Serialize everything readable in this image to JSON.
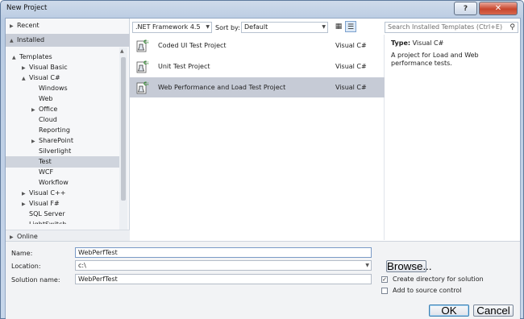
{
  "window": {
    "title": "New Project",
    "help_label": "?",
    "close_label": "✕"
  },
  "left": {
    "recent": "Recent",
    "installed": "Installed",
    "online": "Online",
    "tree": [
      {
        "label": "Templates",
        "indent": 0,
        "arrow": "▲",
        "selected": false
      },
      {
        "label": "Visual Basic",
        "indent": 1,
        "arrow": "▶",
        "selected": false
      },
      {
        "label": "Visual C#",
        "indent": 1,
        "arrow": "▲",
        "selected": false
      },
      {
        "label": "Windows",
        "indent": 2,
        "arrow": "",
        "selected": false
      },
      {
        "label": "Web",
        "indent": 2,
        "arrow": "",
        "selected": false
      },
      {
        "label": "Office",
        "indent": 2,
        "arrow": "▶",
        "selected": false
      },
      {
        "label": "Cloud",
        "indent": 2,
        "arrow": "",
        "selected": false
      },
      {
        "label": "Reporting",
        "indent": 2,
        "arrow": "",
        "selected": false
      },
      {
        "label": "SharePoint",
        "indent": 2,
        "arrow": "▶",
        "selected": false
      },
      {
        "label": "Silverlight",
        "indent": 2,
        "arrow": "",
        "selected": false
      },
      {
        "label": "Test",
        "indent": 2,
        "arrow": "",
        "selected": true
      },
      {
        "label": "WCF",
        "indent": 2,
        "arrow": "",
        "selected": false
      },
      {
        "label": "Workflow",
        "indent": 2,
        "arrow": "",
        "selected": false
      },
      {
        "label": "Visual C++",
        "indent": 1,
        "arrow": "▶",
        "selected": false
      },
      {
        "label": "Visual F#",
        "indent": 1,
        "arrow": "▶",
        "selected": false
      },
      {
        "label": "SQL Server",
        "indent": 1,
        "arrow": "",
        "selected": false
      },
      {
        "label": "LightSwitch",
        "indent": 1,
        "arrow": "",
        "selected": false
      }
    ]
  },
  "toolbar": {
    "framework": ".NET Framework 4.5",
    "sort_label": "Sort by:",
    "sort_value": "Default"
  },
  "templates": [
    {
      "name": "Coded UI Test Project",
      "lang": "Visual C#",
      "selected": false
    },
    {
      "name": "Unit Test Project",
      "lang": "Visual C#",
      "selected": false
    },
    {
      "name": "Web Performance and Load Test Project",
      "lang": "Visual C#",
      "selected": true
    }
  ],
  "search": {
    "placeholder": "Search Installed Templates (Ctrl+E)"
  },
  "details": {
    "type_label": "Type:",
    "type_value": "Visual C#",
    "description": "A project for Load and Web performance tests."
  },
  "form": {
    "name_label": "Name:",
    "name_value": "WebPerfTest",
    "location_label": "Location:",
    "location_value": "c:\\",
    "solution_label": "Solution name:",
    "solution_value": "WebPerfTest",
    "browse_label": "Browse...",
    "create_dir_label": "Create directory for solution",
    "create_dir_checked": true,
    "source_control_label": "Add to source control",
    "source_control_checked": false,
    "ok_label": "OK",
    "cancel_label": "Cancel"
  }
}
